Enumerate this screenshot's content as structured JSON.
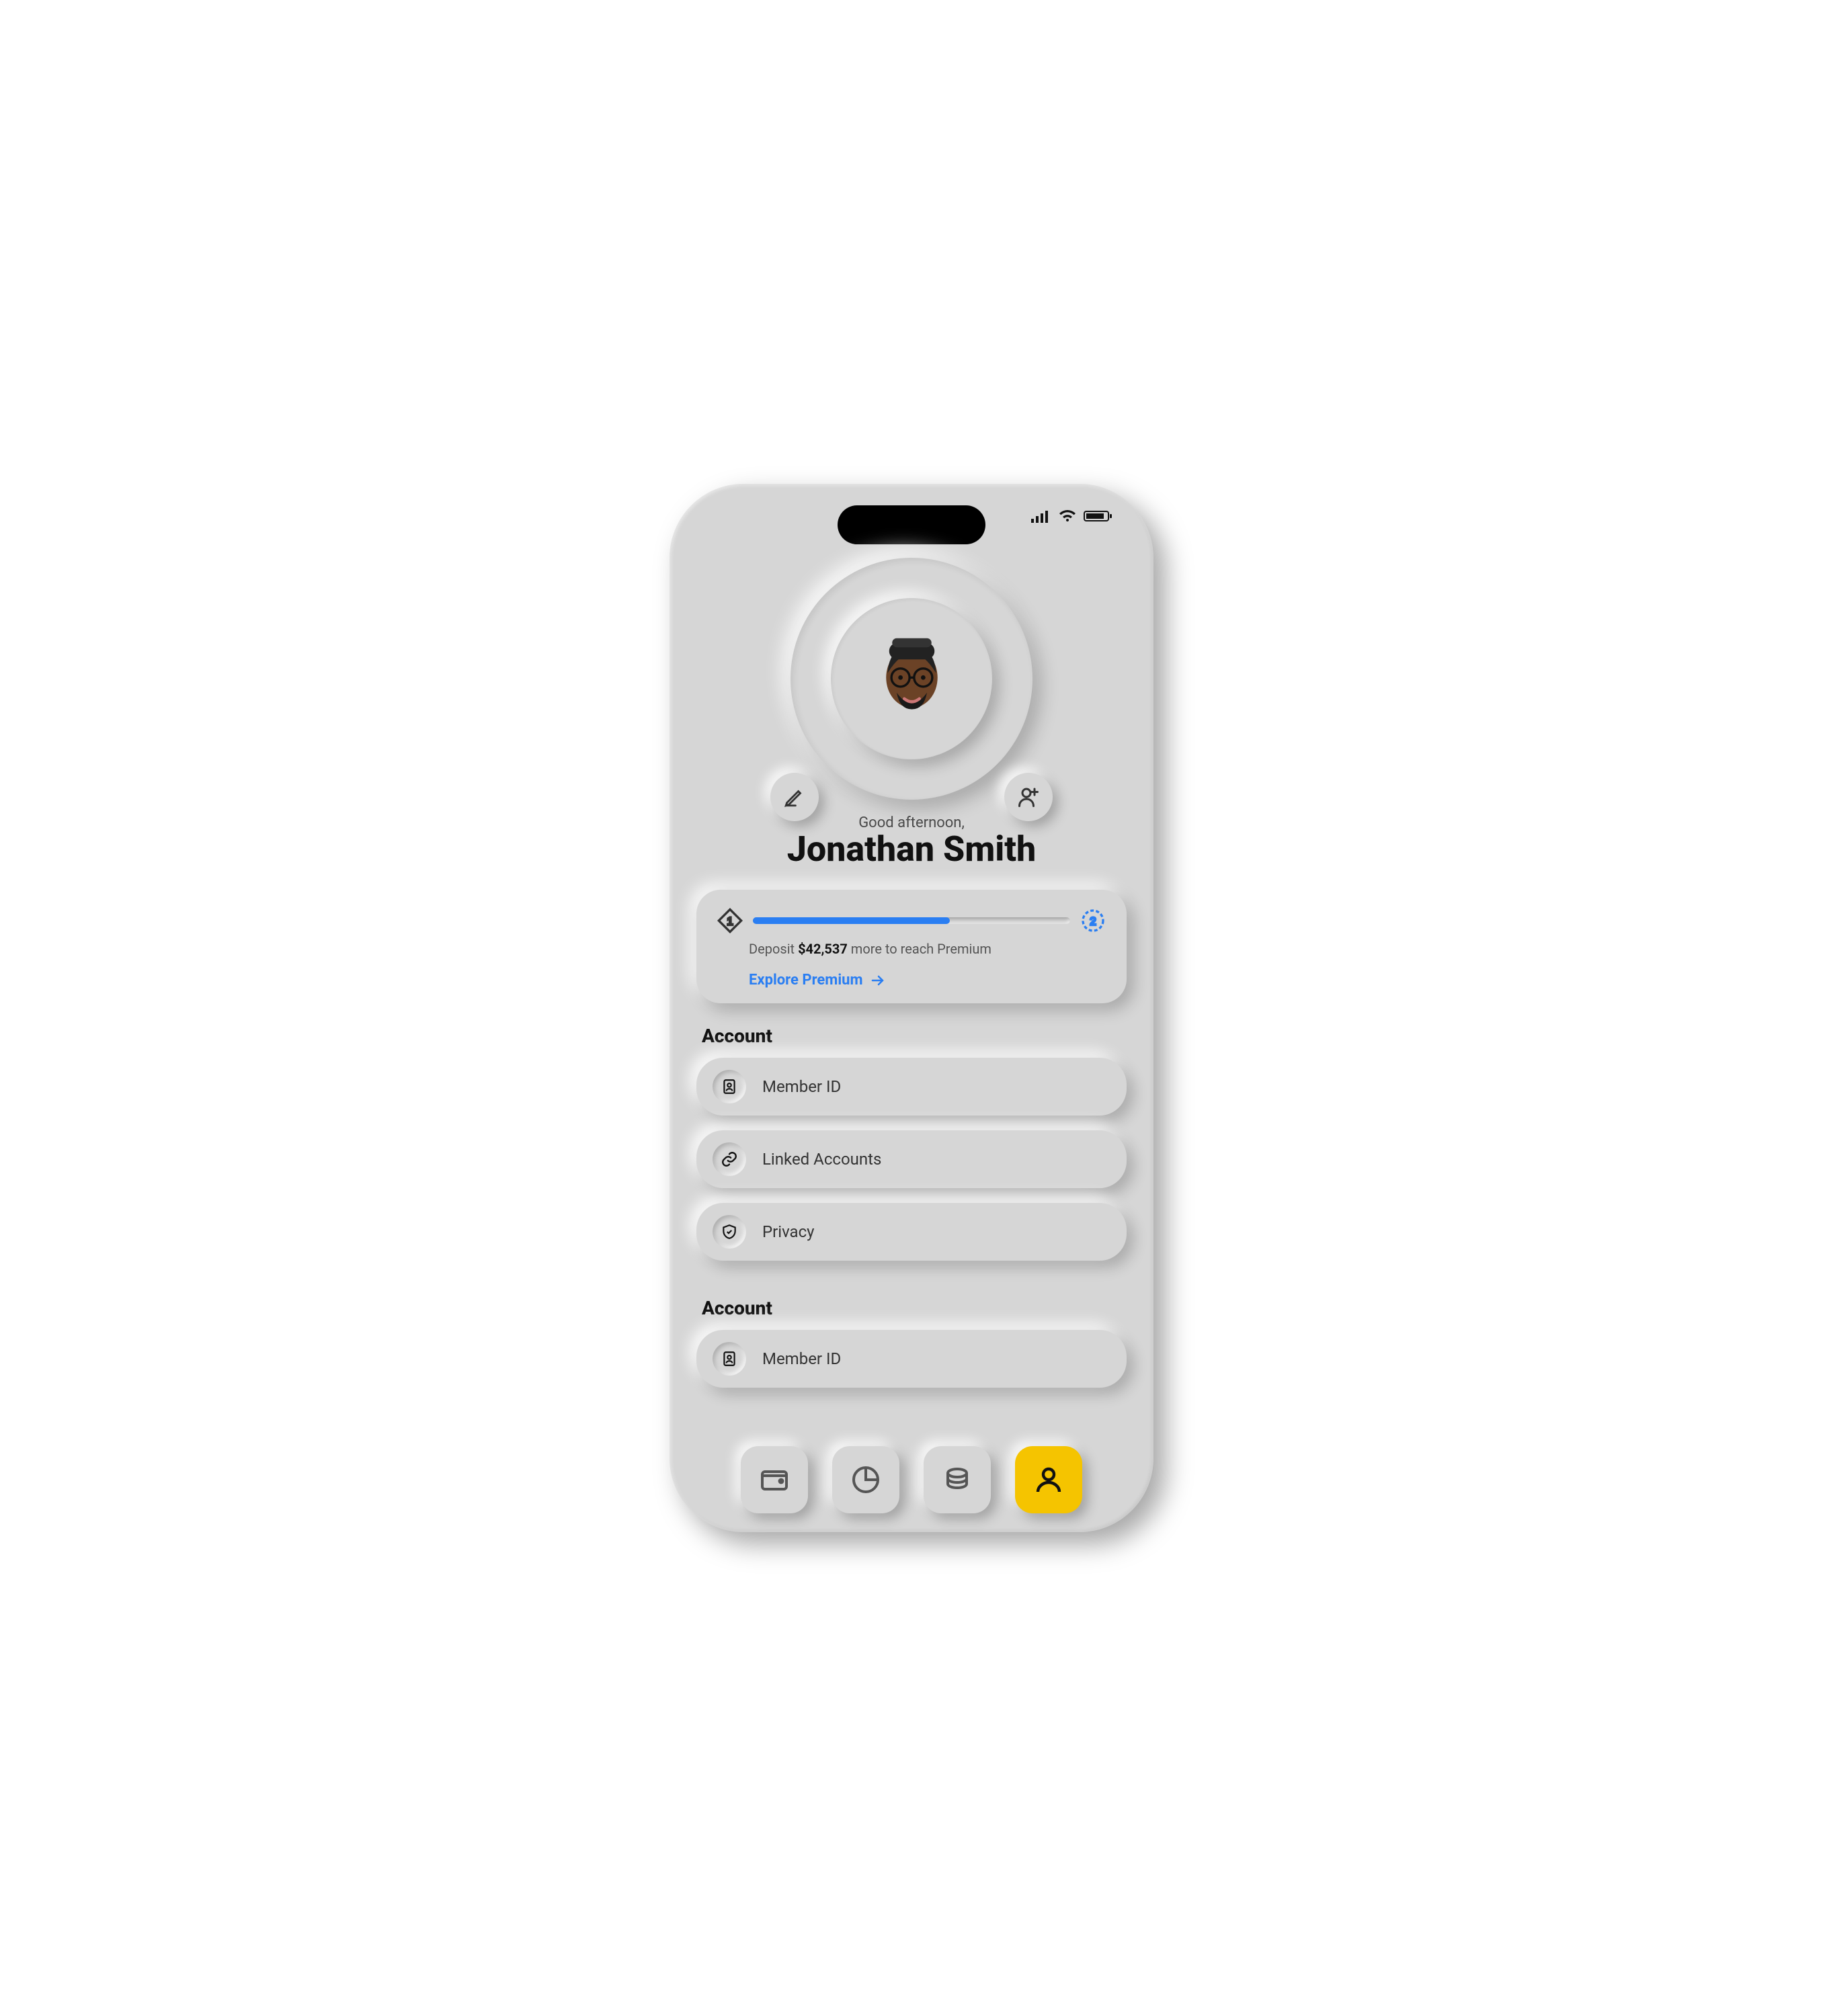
{
  "greeting": "Good afternoon,",
  "user_name": "Jonathan Smith",
  "premium": {
    "progress_pct": 62,
    "deposit_prefix": "Deposit ",
    "deposit_amount": "$42,537",
    "deposit_suffix": " more to reach Premium",
    "explore_label": "Explore Premium",
    "level_left": "1",
    "level_right": "2"
  },
  "sections": [
    {
      "title": "Account",
      "rows": [
        {
          "icon": "id-card-icon",
          "label": "Member ID"
        },
        {
          "icon": "link-icon",
          "label": "Linked Accounts"
        },
        {
          "icon": "shield-icon",
          "label": "Privacy"
        }
      ]
    },
    {
      "title": "Account",
      "rows": [
        {
          "icon": "id-card-icon",
          "label": "Member ID"
        }
      ]
    }
  ],
  "nav": {
    "items": [
      "wallet",
      "chart",
      "coins",
      "profile"
    ],
    "active_index": 3
  },
  "colors": {
    "accent_blue": "#2a7ef2",
    "accent_yellow": "#f5c400",
    "surface": "#d6d6d6"
  }
}
